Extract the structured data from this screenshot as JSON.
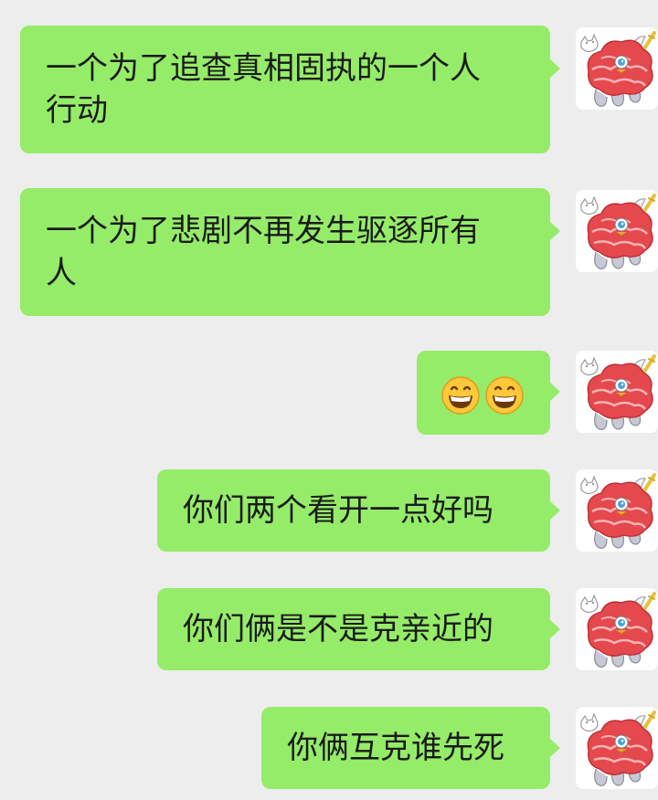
{
  "chat": {
    "messages": [
      {
        "text": "一个为了追查真相固执的一个人\n行动",
        "sender": "self"
      },
      {
        "text": "一个为了悲剧不再发生驱逐所有\n人",
        "sender": "self"
      },
      {
        "text": "",
        "sender": "self",
        "emoji": [
          "grinning-face-emoji",
          "grinning-face-emoji"
        ]
      },
      {
        "text": "你们两个看开一点好吗",
        "sender": "self"
      },
      {
        "text": "你们俩是不是克亲近的",
        "sender": "self"
      },
      {
        "text": "你俩互克谁先死",
        "sender": "self"
      }
    ],
    "avatar": "red-bird-character-avatar"
  },
  "colors": {
    "background": "#ededed",
    "bubble": "#95ec69",
    "text": "#1a1a1a"
  }
}
